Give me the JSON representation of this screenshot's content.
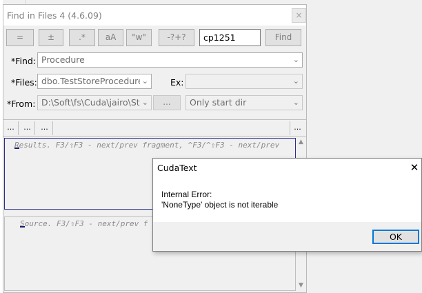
{
  "window": {
    "title": "Find in Files 4 (4.6.09)",
    "close_glyph": "×"
  },
  "toolbar": {
    "buttons": [
      "=",
      "±",
      ".*",
      "aA",
      "\"w\"",
      "-?+?"
    ],
    "encoding_value": "cp1251",
    "find_label": "Find"
  },
  "form": {
    "find_label": "*Find:",
    "find_value": "Procedure",
    "files_label": "*Files:",
    "files_value": "dbo.TestStoreProcedure",
    "ex_label": "Ex:",
    "ex_value": "",
    "from_label": "*From:",
    "from_value": "D:\\Soft\\fs\\Cuda\\jairo\\St",
    "browse_label": "...",
    "depth_value": "Only start dir"
  },
  "dots_bar": {
    "left_buttons": [
      "...",
      "...",
      "..."
    ],
    "right_button": "..."
  },
  "results": {
    "hint": "Results. F3/⇧F3 - next/prev fragment, ^F3/^⇧F3 - next/prev"
  },
  "source": {
    "hint": "Source. F3/⇧F3 - next/prev f"
  },
  "dialog": {
    "title": "CudaText",
    "close_glyph": "✕",
    "line1": "Internal Error:",
    "line2": "'NoneType' object is not iterable",
    "ok_label": "OK"
  },
  "colors": {
    "accent_focus": "#0078d7",
    "results_border": "#2b2d8f",
    "caret": "#1a1a6e"
  }
}
